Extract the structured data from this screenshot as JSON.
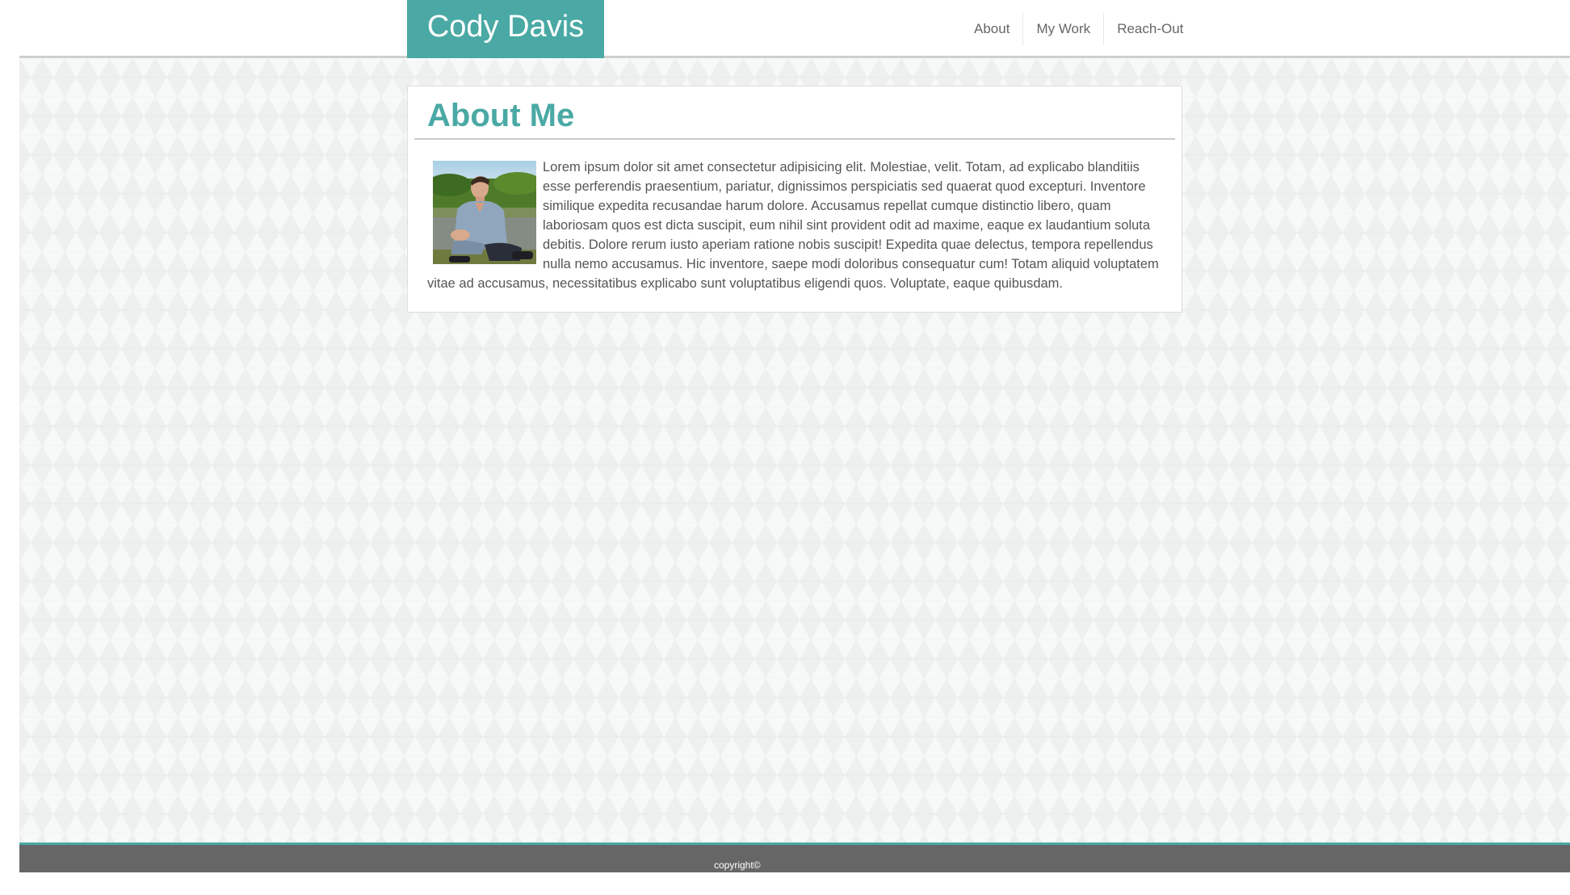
{
  "header": {
    "brand": "Cody Davis",
    "nav": [
      "About",
      "My Work",
      "Reach-Out"
    ]
  },
  "about": {
    "title": "About Me",
    "avatar_alt": "portrait photo",
    "text": "Lorem ipsum dolor sit amet consectetur adipisicing elit. Molestiae, velit. Totam, ad explicabo blanditiis esse perferendis praesentium, pariatur, dignissimos perspiciatis sed quaerat quod excepturi. Inventore similique expedita recusandae harum dolore. Accusamus repellat cumque distinctio libero, quam laboriosam quos est dicta suscipit, eum nihil sint provident odit ad maxime, eaque ex laudantium soluta debitis. Dolore rerum iusto aperiam ratione nobis suscipit! Expedita quae delectus, tempora repellendus nulla nemo accusamus. Hic inventore, saepe modi doloribus consequatur cum! Totam aliquid voluptatem vitae ad accusamus, necessitatibus explicabo sunt voluptatibus eligendi quos. Voluptate, eaque quibusdam."
  },
  "footer": {
    "copyright": "copyright©"
  },
  "colors": {
    "accent": "#4aa9a4",
    "footer_bg": "#666666",
    "text": "#555555"
  }
}
